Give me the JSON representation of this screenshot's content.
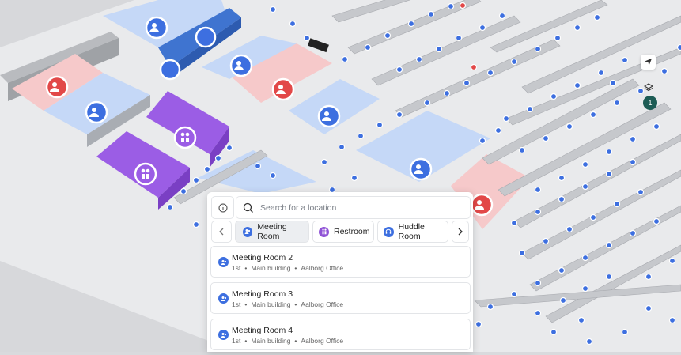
{
  "map": {
    "floor_badge": "1"
  },
  "panel": {
    "search_placeholder": "Search for a location",
    "categories": [
      {
        "label": "Meeting Room",
        "icon": "people-icon",
        "color": "#3d6fe0",
        "active": true
      },
      {
        "label": "Restroom",
        "icon": "restroom-icon",
        "color": "#8f52d6",
        "active": false
      },
      {
        "label": "Huddle Room",
        "icon": "headset-icon",
        "color": "#3d6fe0",
        "active": false
      }
    ],
    "results": [
      {
        "title": "Meeting Room 2",
        "floor": "1st",
        "building": "Main building",
        "venue": "Aalborg Office"
      },
      {
        "title": "Meeting Room 3",
        "floor": "1st",
        "building": "Main building",
        "venue": "Aalborg Office"
      },
      {
        "title": "Meeting Room 4",
        "floor": "1st",
        "building": "Main building",
        "venue": "Aalborg Office"
      }
    ]
  },
  "colors": {
    "meeting_room": "#c5d8f7",
    "restricted_room": "#f6c9ca",
    "restroom": "#9b5de5",
    "desk_dot": "#3d6fe0",
    "accent_dark": "#1d5c55"
  }
}
